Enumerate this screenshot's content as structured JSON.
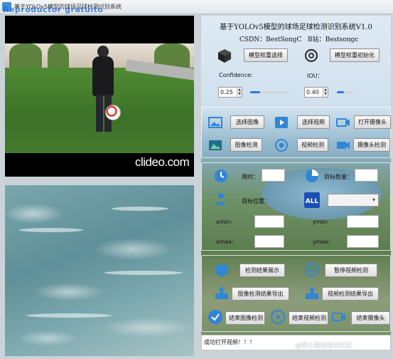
{
  "window": {
    "title": "基于YOLOv5模型的球场足球检测识别系统",
    "watermark_overlay": "Reproductor gratuito"
  },
  "video": {
    "logo": "clideo.com"
  },
  "header": {
    "title": "基于YOLOv5模型的球场足球检测识别系统V1.0",
    "csdn": "CSDN：BestSongC",
    "bilibili": "B站：Bestsongc"
  },
  "model": {
    "select_weights_label": "模型权重选择",
    "init_weights_label": "模型权重初始化",
    "confidence_label": "Confidence:",
    "confidence_value": "0.25",
    "confidence_level": 0.25,
    "iou_label": "IOU：",
    "iou_value": "0.40",
    "iou_level": 0.4
  },
  "source_buttons": {
    "select_image": "选择图像",
    "select_video": "选择视频",
    "open_camera": "打开摄像头",
    "image_detect": "图像检测",
    "video_detect": "视频检测",
    "camera_detect": "摄像头检测"
  },
  "results": {
    "time_label": "用时：",
    "time_value": "",
    "count_label": "目标数量：",
    "count_value": "",
    "position_label": "目标位置：",
    "class_select_value": "",
    "xmin_label": "xmin:",
    "xmin_value": "",
    "ymin_label": "ymin:",
    "ymin_value": "",
    "xmax_label": "xmax:",
    "xmax_value": "",
    "ymax_label": "ymax:",
    "ymax_value": "",
    "all_icon_text": "ALL"
  },
  "actions": {
    "show_results": "检测结果展示",
    "pause_video": "暂停视频检测",
    "export_image_results": "图像检测结果导出",
    "export_video_results": "视频检测结果导出",
    "end_image_detect": "结束图像检测",
    "end_video_detect": "结束视频检测",
    "end_camera": "结束摄像头"
  },
  "status": {
    "message": "成功打开视频！！！"
  },
  "corner_watermark": "@稀土掘金技术社区",
  "colors": {
    "accent": "#2b79d8",
    "icon_blue": "#2f86d6",
    "panel_border": "#ffffff"
  }
}
